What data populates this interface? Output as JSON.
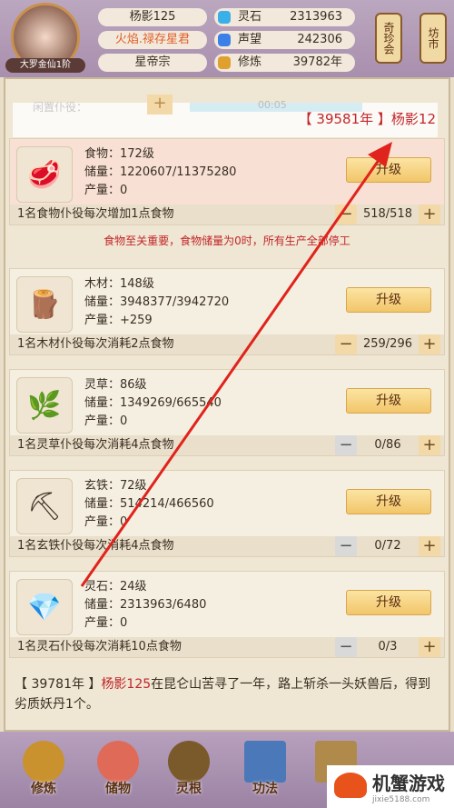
{
  "header": {
    "rank": "大罗金仙1阶",
    "name": "杨影125",
    "title": "火焰.禄存星君",
    "sect": "星帝宗",
    "resources": [
      {
        "label": "灵石",
        "value": "2313963",
        "color": "#3ab0e8"
      },
      {
        "label": "声望",
        "value": "242306",
        "color": "#3a80e8"
      },
      {
        "label": "修炼",
        "value": "39782年",
        "color": "#e0a030"
      }
    ],
    "lanterns": [
      "奇珍会",
      "坊市"
    ]
  },
  "banner": {
    "idle_label": "闲置仆役：",
    "time": "00:05",
    "message": "【 39581年 】杨影12"
  },
  "cards": [
    {
      "icon": "meat-icon",
      "name": "食物：172级",
      "storage": "储量：1220607/11375280",
      "output": "产量：0",
      "upgrade": "升级",
      "footer": "1名食物仆役每次增加1点食物",
      "count": "518/518"
    },
    {
      "icon": "wood-icon",
      "name": "木材：148级",
      "storage": "储量：3948377/3942720",
      "output": "产量：+259",
      "upgrade": "升级",
      "footer": "1名木材仆役每次消耗2点食物",
      "count": "259/296"
    },
    {
      "icon": "herb-icon",
      "name": "灵草：86级",
      "storage": "储量：1349269/665540",
      "output": "产量：0",
      "upgrade": "升级",
      "footer": "1名灵草仆役每次消耗4点食物",
      "count": "0/86"
    },
    {
      "icon": "iron-icon",
      "name": "玄铁：72级",
      "storage": "储量：514214/466560",
      "output": "产量：0",
      "upgrade": "升级",
      "footer": "1名玄铁仆役每次消耗4点食物",
      "count": "0/72"
    },
    {
      "icon": "spirit-stone-icon",
      "name": "灵石：24级",
      "storage": "储量：2313963/6480",
      "output": "产量：0",
      "upgrade": "升级",
      "footer": "1名灵石仆役每次消耗10点食物",
      "count": "0/3"
    }
  ],
  "warning": "食物至关重要，食物储量为0时，所有生产全部停工",
  "log": {
    "year": "【 39781年 】",
    "name": "杨影125",
    "text": "在昆仑山苦寻了一年，路上斩杀一头妖兽后，得到劣质妖丹1个。"
  },
  "nav": [
    "修炼",
    "储物",
    "灵根",
    "功法"
  ],
  "watermark": {
    "title": "机蟹游戏",
    "url": "jixie5188.com"
  }
}
